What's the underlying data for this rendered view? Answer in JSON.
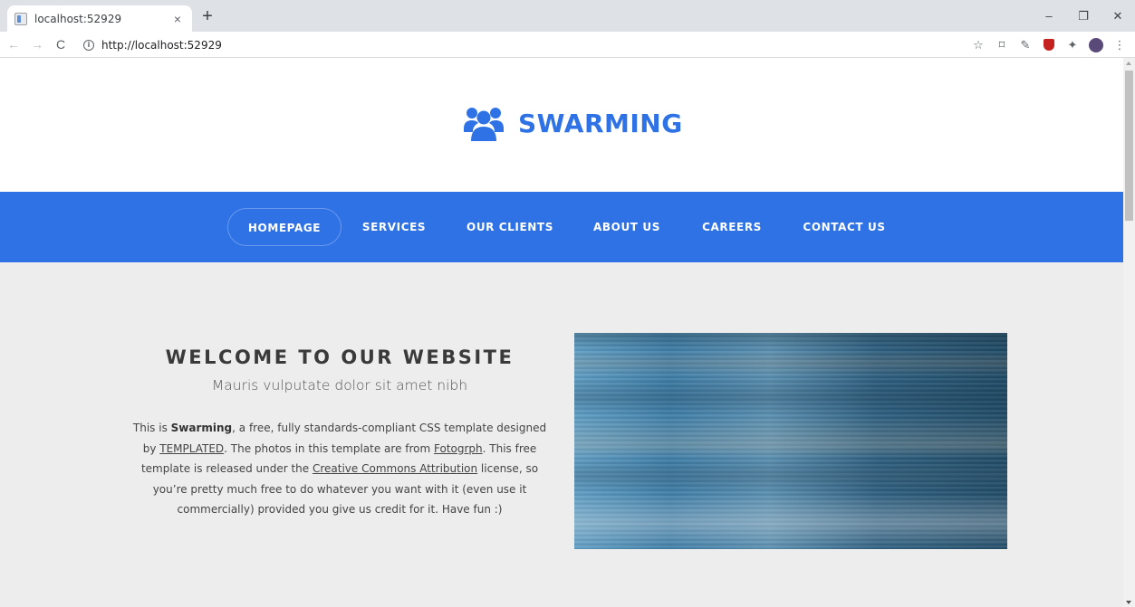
{
  "browser": {
    "tab_title": "localhost:52929",
    "tab_close": "×",
    "new_tab": "+",
    "url": "http://localhost:52929",
    "window_controls": {
      "minimize": "–",
      "restore": "❐",
      "close": "✕"
    },
    "nav": {
      "back": "←",
      "forward": "→",
      "reload": "C"
    },
    "extensions": [
      "star-icon",
      "screen-capture-icon",
      "eyedropper-icon",
      "ublock-icon",
      "puzzle-icon",
      "profile-icon",
      "more-icon"
    ]
  },
  "site": {
    "brand": "SWARMING",
    "brand_color": "#2e72e6",
    "nav": [
      {
        "label": "HOMEPAGE",
        "active": true
      },
      {
        "label": "SERVICES"
      },
      {
        "label": "OUR CLIENTS"
      },
      {
        "label": "ABOUT US"
      },
      {
        "label": "CAREERS"
      },
      {
        "label": "CONTACT US"
      }
    ],
    "welcome": {
      "title": "WELCOME TO OUR WEBSITE",
      "subtitle": "Mauris vulputate dolor sit amet nibh",
      "p_intro": "This is ",
      "p_brand": "Swarming",
      "p_1": ", a free, fully standards-compliant CSS template designed by ",
      "link_templated": "TEMPLATED",
      "p_2": ". The photos in this template are from ",
      "link_fotogrph": "Fotogrph",
      "p_3": ". This free template is released under the ",
      "link_cc": "Creative Commons Attribution",
      "p_4": " license, so you’re pretty much free to do whatever you want with it (even use it commercially) provided you give us credit for it. Have fun :)"
    }
  }
}
